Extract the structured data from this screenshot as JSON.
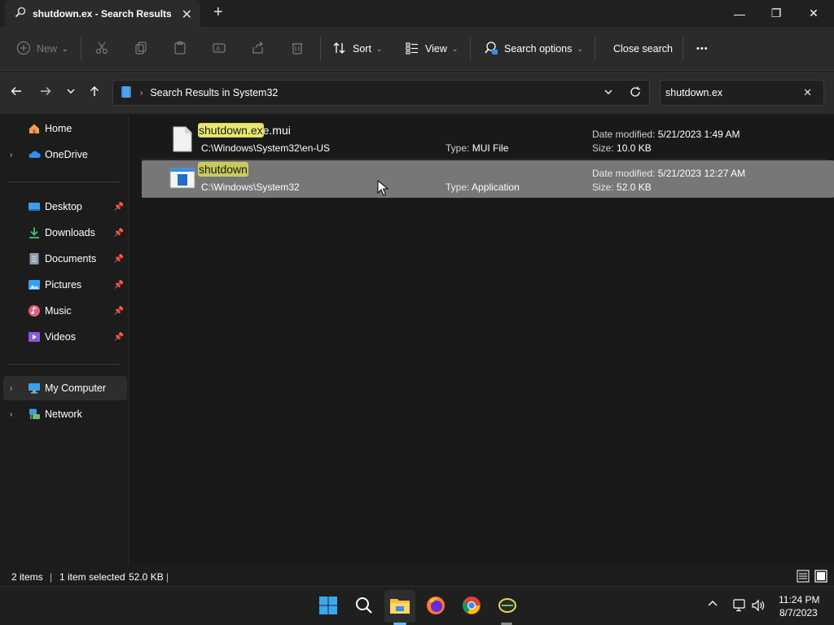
{
  "window": {
    "tab_title": "shutdown.ex - Search Results",
    "new_tab": "+",
    "minimize": "—",
    "maximize": "❐",
    "close": "✕"
  },
  "toolbar": {
    "new_label": "New",
    "sort_label": "Sort",
    "view_label": "View",
    "search_options_label": "Search options",
    "close_search_label": "Close search",
    "more_label": "•••"
  },
  "address": {
    "crumb": "Search Results in System32"
  },
  "search": {
    "value": "shutdown.ex"
  },
  "sidebar": {
    "items": [
      {
        "label": "Home",
        "icon": "home-icon"
      },
      {
        "label": "OneDrive",
        "icon": "onedrive-icon"
      },
      {
        "label": "Desktop",
        "icon": "desktop-icon"
      },
      {
        "label": "Downloads",
        "icon": "downloads-icon"
      },
      {
        "label": "Documents",
        "icon": "documents-icon"
      },
      {
        "label": "Pictures",
        "icon": "pictures-icon"
      },
      {
        "label": "Music",
        "icon": "music-icon"
      },
      {
        "label": "Videos",
        "icon": "videos-icon"
      },
      {
        "label": "My Computer",
        "icon": "computer-icon"
      },
      {
        "label": "Network",
        "icon": "network-icon"
      }
    ]
  },
  "results": [
    {
      "name_highlight": "shutdown.ex",
      "name_rest": "e.mui",
      "path": "C:\\Windows\\System32\\en-US",
      "type_key": "Type:",
      "type_value": "MUI File",
      "date_key": "Date modified:",
      "date_value": "5/21/2023 1:49 AM",
      "size_key": "Size:",
      "size_value": "10.0 KB",
      "selected": false
    },
    {
      "name_highlight": "shutdown",
      "name_rest": "",
      "path": "C:\\Windows\\System32",
      "type_key": "Type:",
      "type_value": "Application",
      "date_key": "Date modified:",
      "date_value": "5/21/2023 12:27 AM",
      "size_key": "Size:",
      "size_value": "52.0 KB",
      "selected": true
    }
  ],
  "status": {
    "items_count": "2 items",
    "selection": "1 item selected",
    "selection_size": "52.0 KB"
  },
  "taskbar": {
    "time": "11:24 PM",
    "date": "8/7/2023"
  },
  "colors": {
    "accent": "#0078d4",
    "highlight": "#e8e870",
    "selected_row": "#777777"
  }
}
